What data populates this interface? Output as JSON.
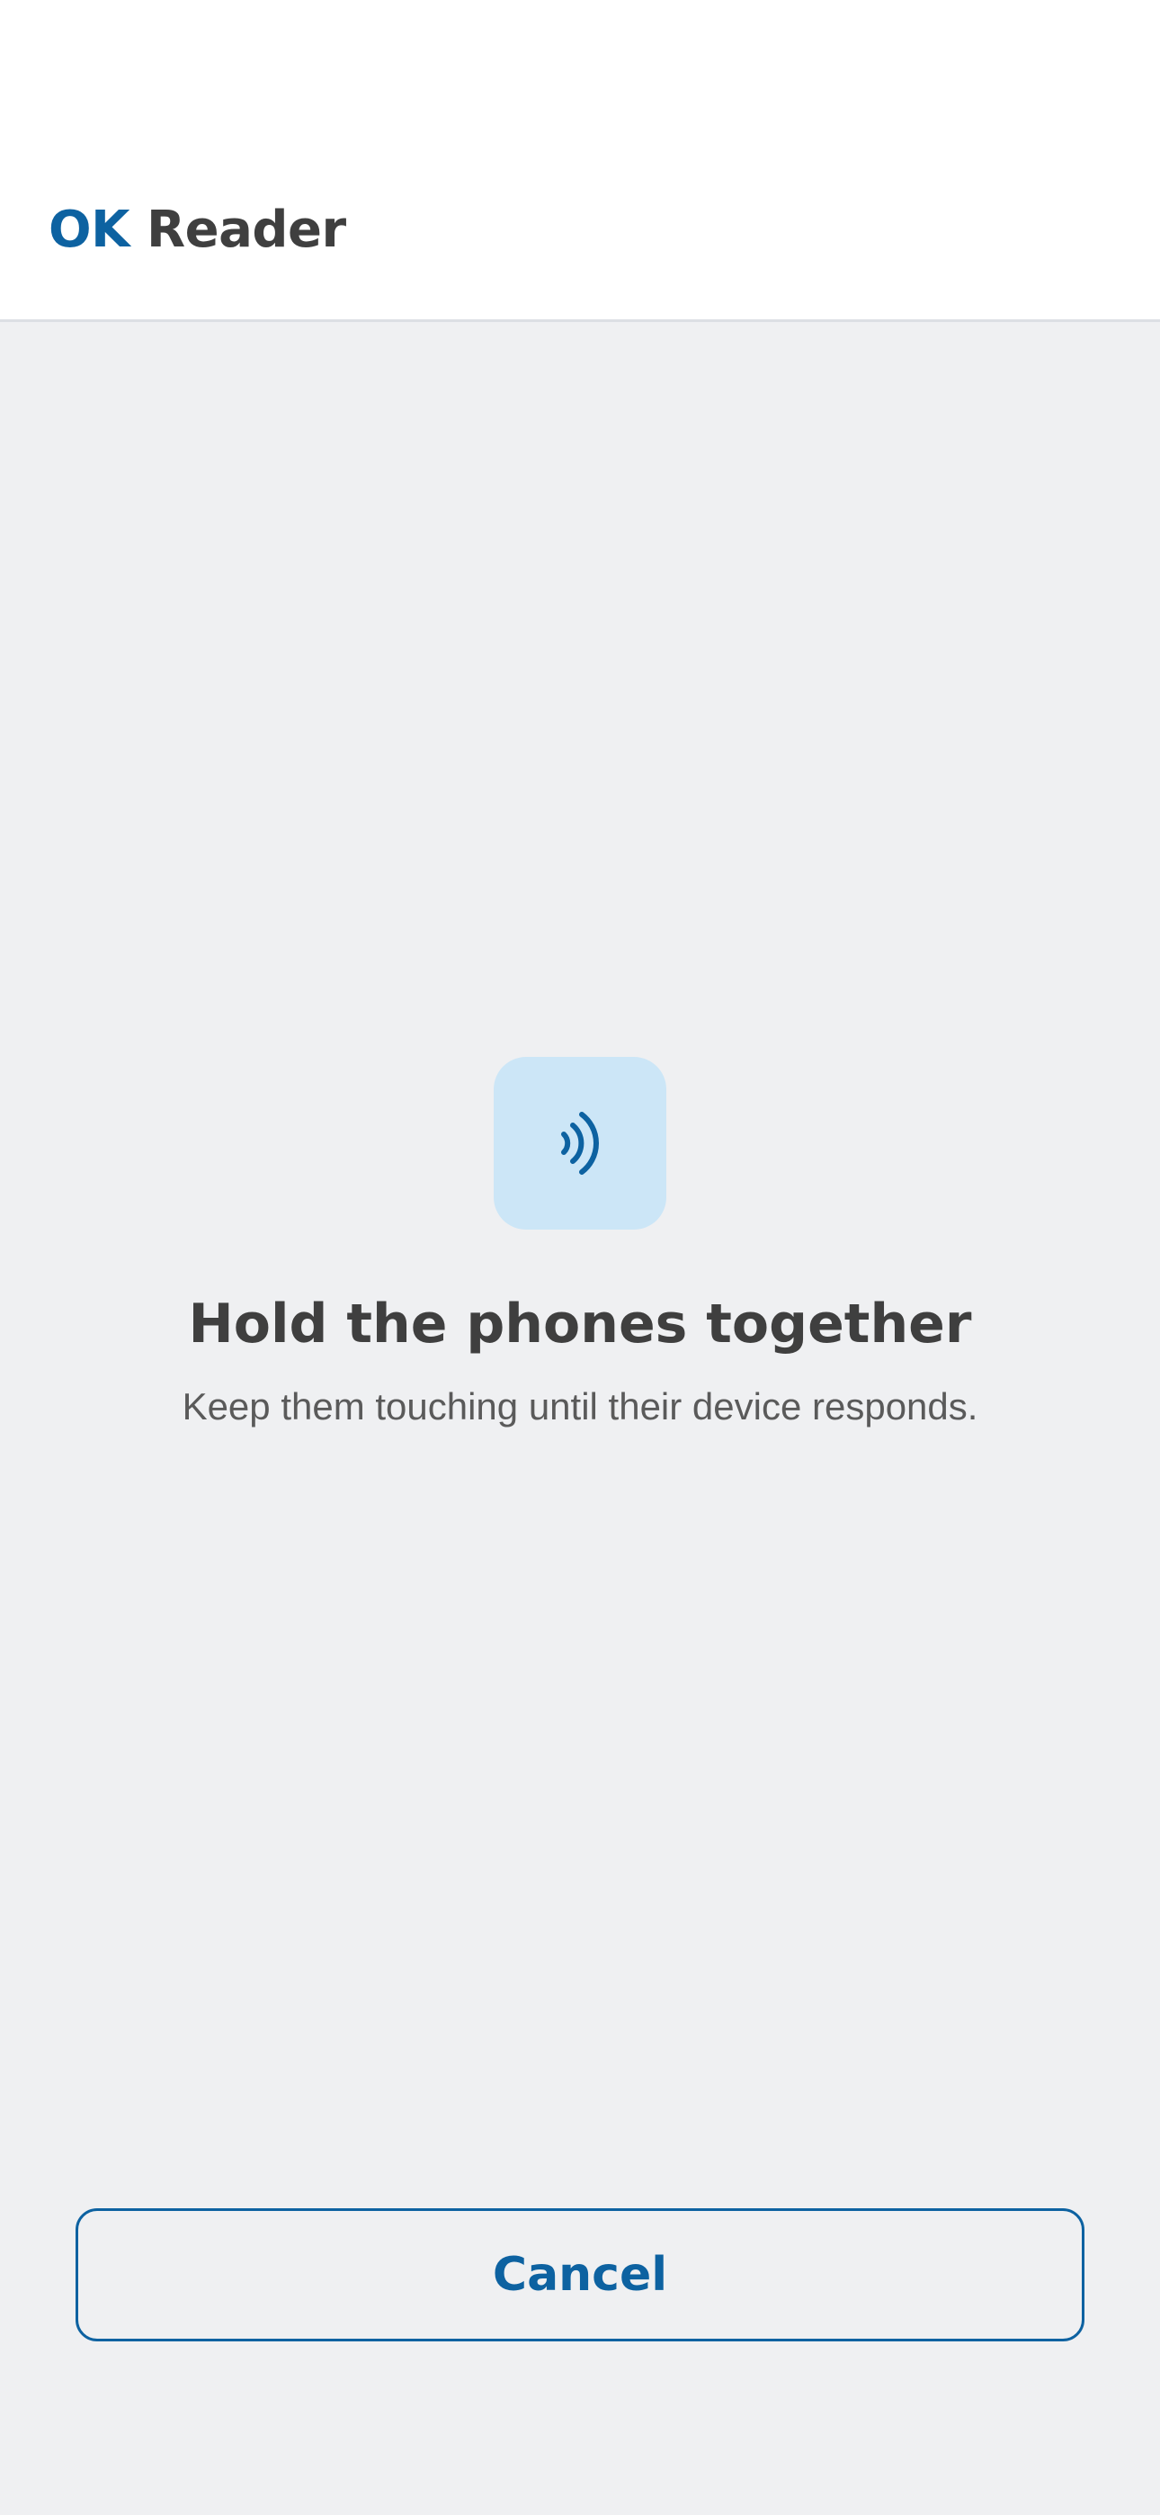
{
  "header": {
    "brand_accent": "OK",
    "brand_name": "Reader"
  },
  "main": {
    "icon": "nfc-contactless-icon",
    "title": "Hold the phones together",
    "subtitle": "Keep them touching until their device responds."
  },
  "footer": {
    "cancel_label": "Cancel"
  },
  "colors": {
    "accent": "#0d62a1",
    "icon_tile": "#cce6f7",
    "background": "#eff0f2",
    "text_primary": "#3f3f3f",
    "text_secondary": "#5a5a5a"
  }
}
